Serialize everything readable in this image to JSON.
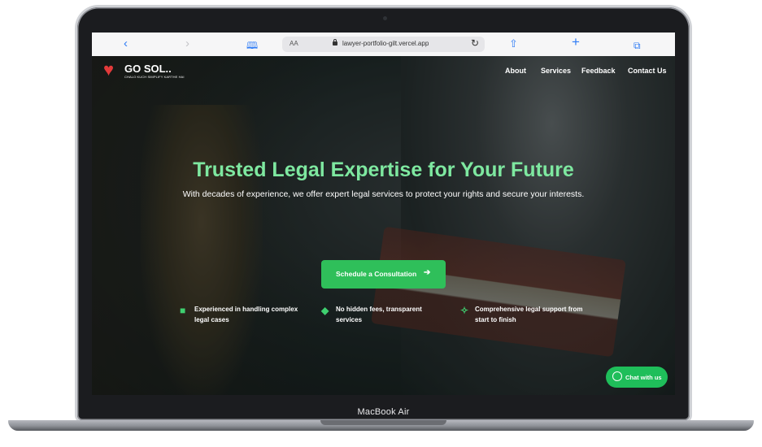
{
  "device": {
    "label": "MacBook Air"
  },
  "browser": {
    "back_icon": "chevron-left-icon",
    "forward_icon": "chevron-right-icon",
    "reader_icon": "book-icon",
    "text_size": "AA",
    "url": "lawyer-portfolio-gilt.vercel.app",
    "reload_icon": "reload-icon",
    "share_icon": "share-icon",
    "new_tab_icon": "plus-icon",
    "tabs_icon": "tabs-icon"
  },
  "site": {
    "logo_title": "GO SOL..",
    "logo_tagline": "CHALO KUCH SIMPLIFY KARTHE HAI",
    "nav": [
      "About",
      "Services",
      "Feedback",
      "Contact Us"
    ]
  },
  "hero": {
    "title": "Trusted Legal Expertise for Your Future",
    "subtitle": "With decades of experience, we offer expert legal services to protect your rights and secure your interests.",
    "cta_label": "Schedule a Consultation",
    "features": [
      {
        "icon": "briefcase-icon",
        "text": "Experienced in handling complex legal cases"
      },
      {
        "icon": "shield-icon",
        "text": "No hidden fees, transparent services"
      },
      {
        "icon": "handshake-icon",
        "text": "Comprehensive legal support from start to finish"
      }
    ]
  },
  "chat": {
    "label": "Chat with us",
    "icon": "whatsapp-icon"
  },
  "colors": {
    "accent": "#2fbf5a",
    "headline": "#7ee8a0",
    "chat": "#1fbe5a",
    "link": "#2f7cf6"
  }
}
